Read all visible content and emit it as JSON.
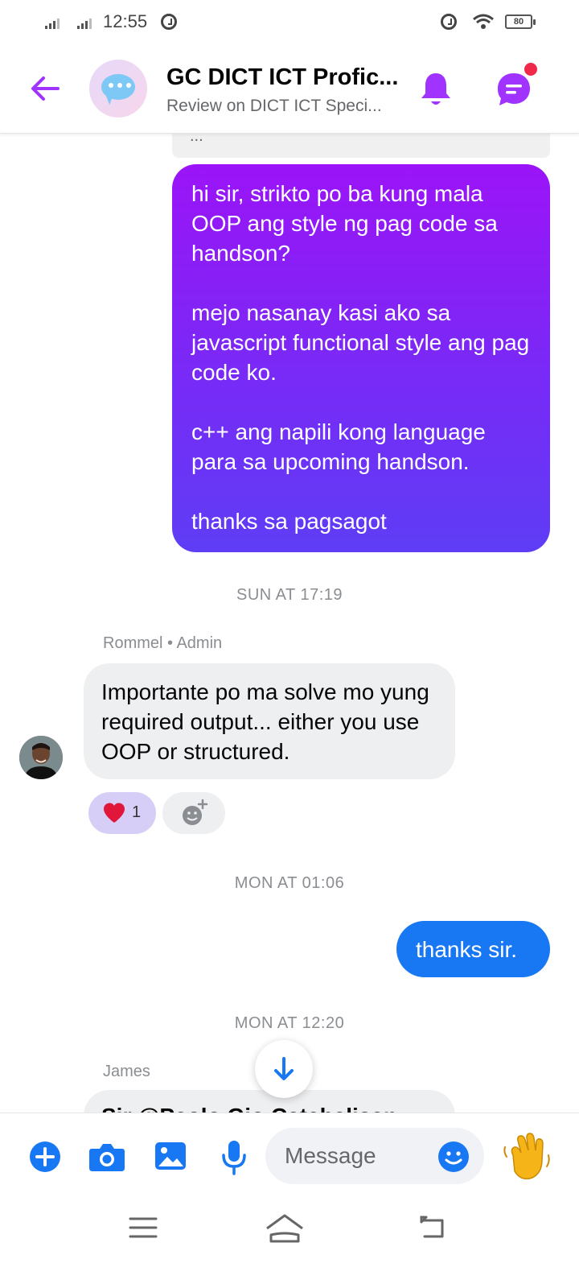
{
  "status_bar": {
    "time": "12:55",
    "battery": "80"
  },
  "header": {
    "title": "GC DICT ICT Profic...",
    "subtitle": "Review on DICT ICT Speci...",
    "icons": {
      "back": "arrow-left-icon",
      "notifications": "bell-icon",
      "threads": "chat-threads-icon"
    },
    "accent_color": "#a033ff",
    "badge_color": "#f02849"
  },
  "chat": {
    "quoted_reply_text": "...",
    "messages": [
      {
        "direction": "outgoing",
        "text": "hi sir, strikto po ba kung mala OOP ang style ng pag code sa handson?\n\nmejo nasanay kasi ako sa javascript functional style ang pag code ko.\n\nc++ ang napili kong language para sa upcoming handson.\n\nthanks sa pagsagot"
      },
      {
        "timestamp": "SUN AT 17:19",
        "sender": "Rommel • Admin",
        "direction": "incoming",
        "text": "Importante po ma solve mo yung required output... either you use OOP or structured.",
        "reactions": {
          "emoji": "heart",
          "count": "1"
        }
      },
      {
        "timestamp": "MON AT 01:06",
        "direction": "outgoing",
        "text": "thanks sir."
      },
      {
        "timestamp": "MON AT 12:20",
        "sender": "James",
        "direction": "incoming",
        "text": "Sir @Paolo Gio Catabalisan..."
      }
    ],
    "bubble_colors": {
      "outgoing_gradient_start": "#9b14f7",
      "outgoing_gradient_end": "#5e3df5",
      "outgoing_solid": "#1877f2",
      "incoming": "#eeeff1"
    }
  },
  "composer": {
    "placeholder": "Message",
    "icons": [
      "plus-icon",
      "camera-icon",
      "gallery-icon",
      "microphone-icon",
      "emoji-icon",
      "waving-hand-icon"
    ],
    "accent_color": "#1877f2"
  },
  "navbar": {
    "icons": [
      "menu-icon",
      "home-icon",
      "back-icon"
    ]
  }
}
